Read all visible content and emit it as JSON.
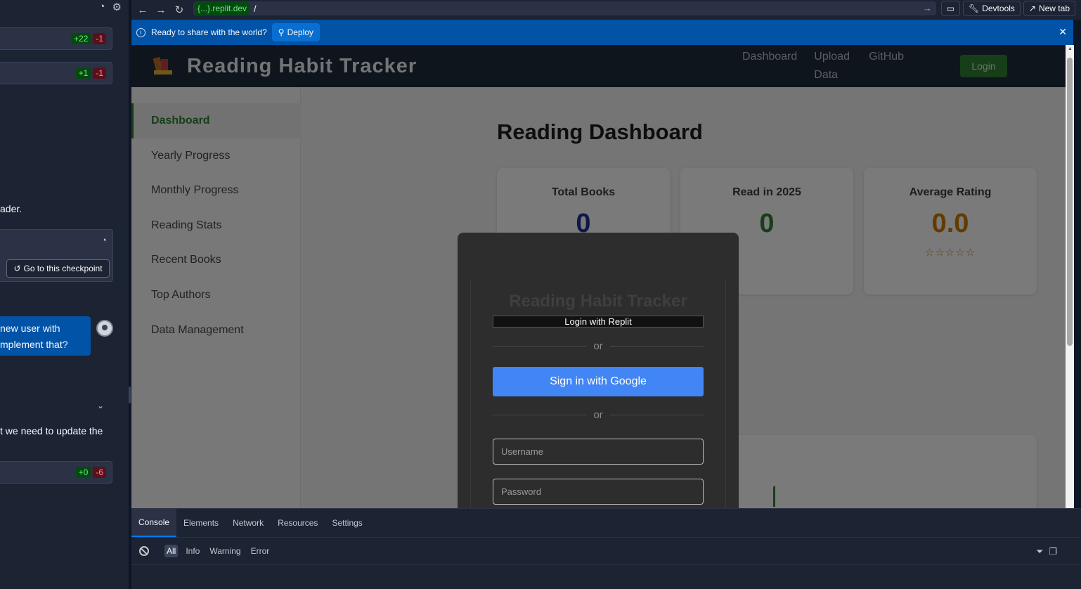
{
  "left_panel": {
    "file_changes": [
      {
        "plus": "+22",
        "minus": "-1"
      },
      {
        "plus": "+1",
        "minus": "-1"
      },
      {
        "plus": "+0",
        "minus": "-6"
      }
    ],
    "text_fragment_1": "ader.",
    "checkpoint_button": "Go to this checkpoint",
    "user_message_line1": "new user with",
    "user_message_line2": "mplement that?",
    "text_fragment_2": "t we need to update the"
  },
  "browser": {
    "url_host": "{...}.replit.dev",
    "url_path": "/",
    "devtools_label": "Devtools",
    "new_tab_label": "New tab"
  },
  "banner": {
    "message": "Ready to share with the world?",
    "deploy_label": "Deploy"
  },
  "app": {
    "title": "Reading Habit Tracker",
    "nav": [
      "Dashboard",
      "Upload Data",
      "GitHub"
    ],
    "login_label": "Login",
    "sidebar": [
      "Dashboard",
      "Yearly Progress",
      "Monthly Progress",
      "Reading Stats",
      "Recent Books",
      "Top Authors",
      "Data Management"
    ],
    "dashboard_title": "Reading Dashboard",
    "stats": [
      {
        "label": "Total Books",
        "value": "0",
        "color": "#1e2f8f"
      },
      {
        "label": "Read in 2025",
        "value": "0",
        "color": "#2e7d32"
      },
      {
        "label": "Average Rating",
        "value": "0.0",
        "color": "#c77700"
      }
    ],
    "stars": "☆☆☆☆☆"
  },
  "modal": {
    "title": "Reading Habit Tracker",
    "replit_login": "Login with Replit",
    "or": "or",
    "google_signin": "Sign in with Google",
    "username_placeholder": "Username",
    "password_placeholder": "Password"
  },
  "devtools": {
    "tabs": [
      "Console",
      "Elements",
      "Network",
      "Resources",
      "Settings"
    ],
    "levels": [
      "All",
      "Info",
      "Warning",
      "Error"
    ]
  },
  "colors": {
    "replit_blue": "#0053a6",
    "app_green": "#2e7d32",
    "google_blue": "#4285f4"
  }
}
